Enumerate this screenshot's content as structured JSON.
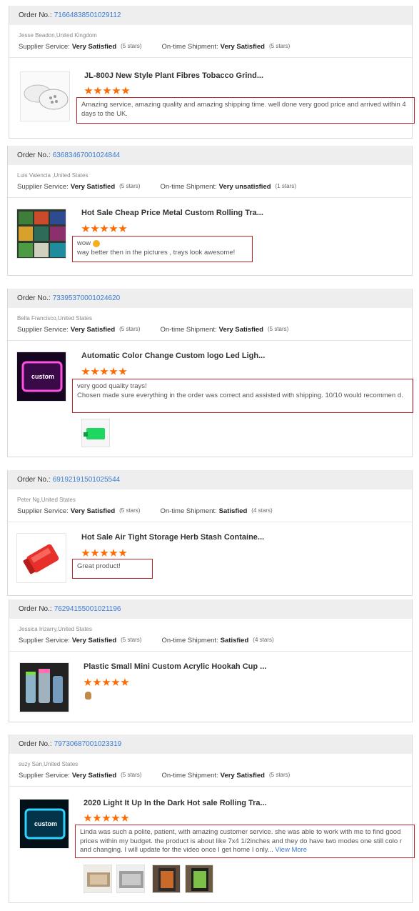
{
  "orders": [
    {
      "order_label": "Order No.:",
      "order_no": "71664838501029112",
      "buyer": "Jesse Beadon,United Kingdom",
      "supplier_label": "Supplier Service:",
      "supplier_rating": "Very Satisfied",
      "supplier_stars": "(5 stars)",
      "shipment_label": "On-time Shipment:",
      "shipment_rating": "Very Satisfied",
      "shipment_stars": "(5 stars)",
      "product_title": "JL-800J New Style Plant Fibres Tobacco Grind...",
      "rating": 5,
      "review": "Amazing service, amazing quality and amazing shipping time. well done very good price and arrived within 4 days to the UK.",
      "thumb_icon": "grinder-image"
    },
    {
      "order_label": "Order No.:",
      "order_no": "63683467001024844",
      "buyer": "Luis Valencia ,United States",
      "supplier_label": "Supplier Service:",
      "supplier_rating": "Very Satisfied",
      "supplier_stars": "(5 stars)",
      "shipment_label": "On-time Shipment:",
      "shipment_rating": "Very unsatisfied",
      "shipment_stars": "(1 stars)",
      "product_title": "Hot Sale Cheap Price Metal Custom Rolling Tra...",
      "rating": 5,
      "review_line1": "wow",
      "review_line2": "way better then in the pictures , trays look awesome!",
      "thumb_icon": "rolling-trays-image"
    },
    {
      "order_label": "Order No.:",
      "order_no": "73395370001024620",
      "buyer": "Bella Francisco,United States",
      "supplier_label": "Supplier Service:",
      "supplier_rating": "Very Satisfied",
      "supplier_stars": "(5 stars)",
      "shipment_label": "On-time Shipment:",
      "shipment_rating": "Very Satisfied",
      "shipment_stars": "(5 stars)",
      "product_title": "Automatic Color Change Custom logo Led Ligh...",
      "rating": 5,
      "review": "very good quality trays!\nChosen made sure everything in the order was correct and assisted with shipping. 10/10 would recommen d.",
      "thumb_label": "custom",
      "thumb_icon": "led-tray-image"
    },
    {
      "order_label": "Order No.:",
      "order_no": "69192191501025544",
      "buyer": "Peter Ng,United States",
      "supplier_label": "Supplier Service:",
      "supplier_rating": "Very Satisfied",
      "supplier_stars": "(5 stars)",
      "shipment_label": "On-time Shipment:",
      "shipment_rating": "Satisfied",
      "shipment_stars": "(4 stars)",
      "product_title": "Hot Sale Air Tight Storage Herb Stash Containe...",
      "rating": 5,
      "review": "Great product!",
      "thumb_icon": "storage-container-image"
    },
    {
      "order_label": "Order No.:",
      "order_no": "76294155001021196",
      "buyer": "Jessica Irizarry,United States",
      "supplier_label": "Supplier Service:",
      "supplier_rating": "Very Satisfied",
      "supplier_stars": "(5 stars)",
      "shipment_label": "On-time Shipment:",
      "shipment_rating": "Satisfied",
      "shipment_stars": "(4 stars)",
      "product_title": "Plastic Small Mini Custom Acrylic Hookah Cup ...",
      "rating": 5,
      "thumb_icon": "hookah-cup-image"
    },
    {
      "order_label": "Order No.:",
      "order_no": "79730687001023319",
      "buyer": "suzy San,United States",
      "supplier_label": "Supplier Service:",
      "supplier_rating": "Very Satisfied",
      "supplier_stars": "(5 stars)",
      "shipment_label": "On-time Shipment:",
      "shipment_rating": "Very Satisfied",
      "shipment_stars": "(5 stars)",
      "product_title": "2020 Light It Up In the Dark Hot sale Rolling Tra...",
      "rating": 5,
      "review": "Linda was such a polite, patient, with amazing customer service. she was able to work with me to find good prices within my budget. the product is about like 7x4 1/2inches and they do have two modes one still colo r and changing.  I will update for the video once I get home I only...",
      "view_more": "View More",
      "thumb_label": "custom",
      "thumb_icon": "glow-tray-image"
    }
  ]
}
